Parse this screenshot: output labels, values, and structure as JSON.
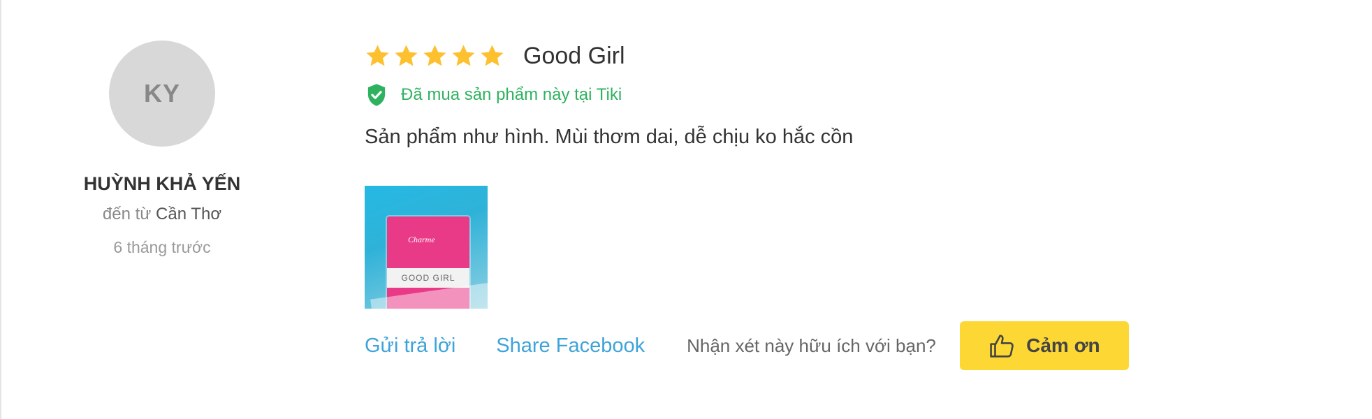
{
  "reviewer": {
    "initials": "KY",
    "name": "HUỲNH KHẢ YẾN",
    "location_prefix": "đến từ",
    "location_city": "Cần Thơ",
    "time_ago": "6 tháng trước"
  },
  "review": {
    "rating": 5,
    "max_rating": 5,
    "star_color": "#fdc02f",
    "title": "Good Girl",
    "verified_text": "Đã mua sản phẩm này tại Tiki",
    "verified_color": "#2fb260",
    "body": "Sản phẩm như hình. Mùi thơm dai, dễ chịu ko hắc cồn",
    "photo": {
      "brand_text": "Charme",
      "label_text": "GOOD GIRL"
    }
  },
  "actions": {
    "reply_label": "Gửi trả lời",
    "share_label": "Share Facebook",
    "helpful_question": "Nhận xét này hữu ích với bạn?",
    "thanks_label": "Cảm ơn",
    "thanks_icon": "thumbs-up-icon",
    "thanks_bg": "#fdd835",
    "link_color": "#3da3d9"
  }
}
